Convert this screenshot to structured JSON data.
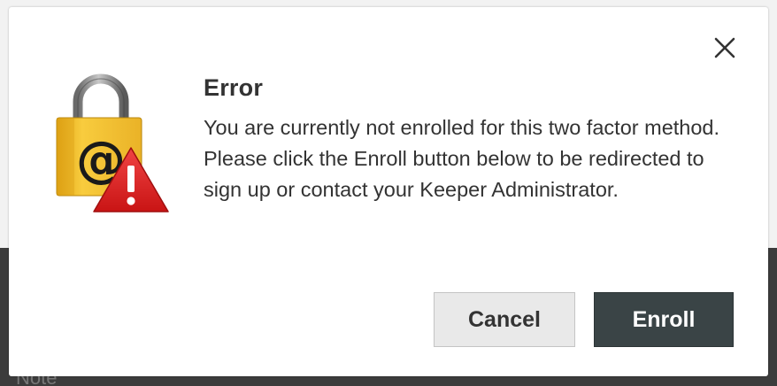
{
  "background": {
    "note_label": "Note"
  },
  "dialog": {
    "title": "Error",
    "message": "You are currently not enrolled for this two factor method. Please click the Enroll button below to be redirected to sign up or contact your Keeper Administrator.",
    "icon": "lock-warning-icon",
    "close_icon": "close-icon",
    "buttons": {
      "cancel_label": "Cancel",
      "enroll_label": "Enroll"
    }
  },
  "colors": {
    "enroll_button_bg": "#3a4446",
    "cancel_button_bg": "#e9e9e9",
    "lock_body": "#f5c431",
    "warning_triangle": "#e32b2b",
    "text": "#333333"
  }
}
